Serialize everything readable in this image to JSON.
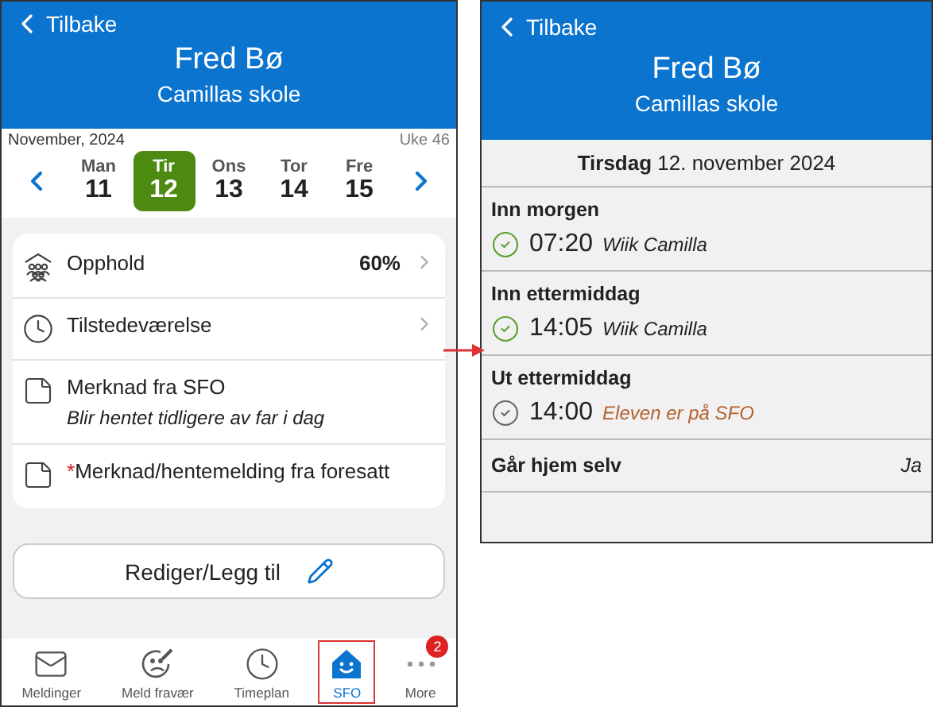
{
  "left": {
    "back_label": "Tilbake",
    "name": "Fred Bø",
    "school": "Camillas skole",
    "month": "November, 2024",
    "week": "Uke 46",
    "days": [
      {
        "weekday": "Man",
        "date": "11",
        "selected": false
      },
      {
        "weekday": "Tir",
        "date": "12",
        "selected": true
      },
      {
        "weekday": "Ons",
        "date": "13",
        "selected": false
      },
      {
        "weekday": "Tor",
        "date": "14",
        "selected": false
      },
      {
        "weekday": "Fre",
        "date": "15",
        "selected": false
      }
    ],
    "rows": [
      {
        "kind": "stay",
        "label": "Opphold",
        "value": "60%"
      },
      {
        "kind": "attendance",
        "label": "Tilstedeværelse"
      },
      {
        "kind": "note",
        "label": "Merknad fra SFO",
        "note": "Blir hentet tidligere av far i dag"
      },
      {
        "kind": "parent-note",
        "label": "Merknad/hentemelding fra foresatt",
        "required": true,
        "required_mark": "*"
      }
    ],
    "action_button": "Rediger/Legg til",
    "tabs": [
      {
        "kind": "mail",
        "label": "Meldinger",
        "selected": false
      },
      {
        "kind": "absence",
        "label": "Meld fravær",
        "selected": false
      },
      {
        "kind": "clock",
        "label": "Timeplan",
        "selected": false
      },
      {
        "kind": "sfo",
        "label": "SFO",
        "selected": true
      },
      {
        "kind": "more",
        "label": "More",
        "selected": false,
        "badge": "2"
      }
    ]
  },
  "right": {
    "back_label": "Tilbake",
    "name": "Fred Bø",
    "school": "Camillas skole",
    "date": "**Tirsdag** 12. november 2024",
    "sections": [
      {
        "kind": "check",
        "title": "Inn morgen",
        "time": "07:20",
        "person": "Wiik Camilla",
        "done": true
      },
      {
        "kind": "check",
        "title": "Inn ettermiddag",
        "time": "14:05",
        "person": "Wiik Camilla",
        "done": true
      },
      {
        "kind": "check",
        "title": "Ut ettermiddag",
        "time": "14:00",
        "person": "Eleven er på SFO",
        "done": false
      },
      {
        "kind": "value",
        "title": "Går hjem selv",
        "value": "Ja"
      }
    ]
  }
}
